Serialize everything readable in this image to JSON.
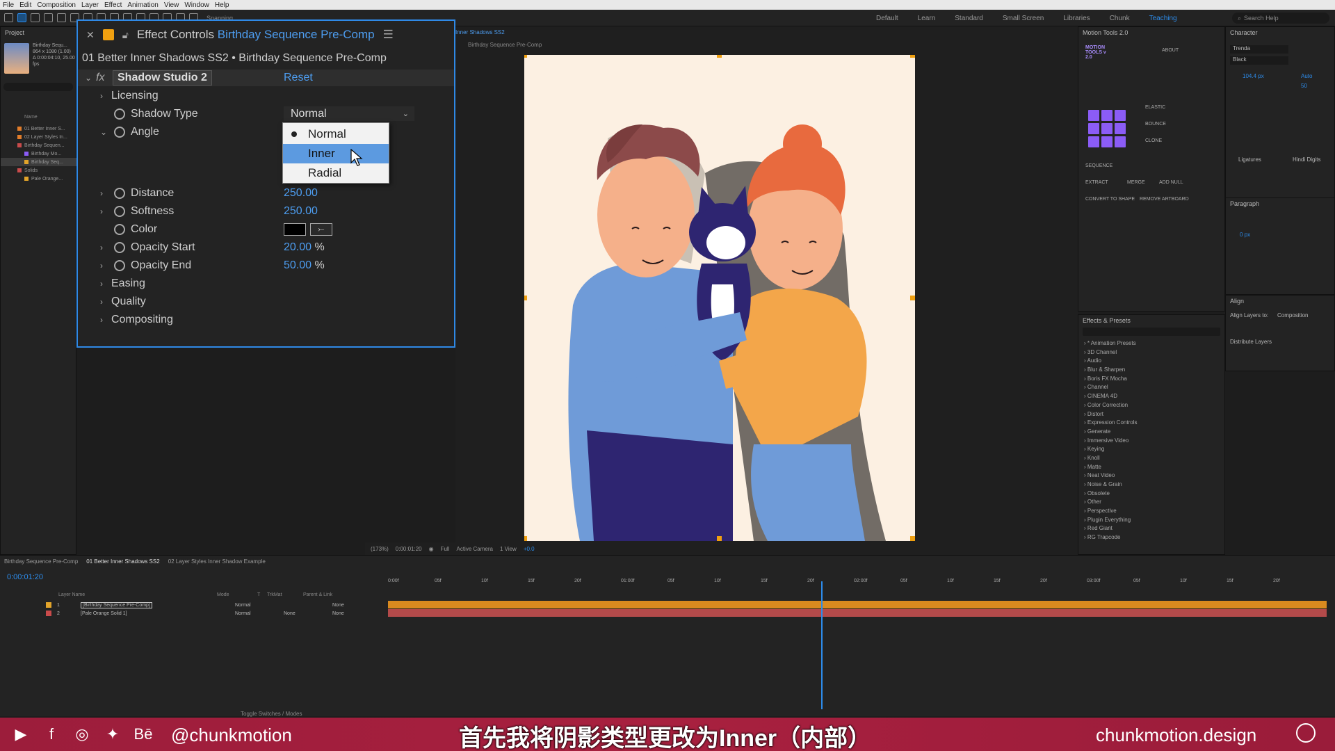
{
  "menu": [
    "File",
    "Edit",
    "Composition",
    "Layer",
    "Effect",
    "Animation",
    "View",
    "Window",
    "Help"
  ],
  "toolbar": {
    "snapping_label": "Snapping"
  },
  "workspaces": [
    "Default",
    "Learn",
    "Standard",
    "Small Screen",
    "Libraries",
    "Chunk",
    "Teaching"
  ],
  "active_workspace": "Teaching",
  "search_help": "Search Help",
  "project": {
    "tab": "Project",
    "item_name": "Birthday Sequ...",
    "item_info1": "864 x 1080 (1.00)",
    "item_info2": "Δ 0:00:04:10, 25.00 fps",
    "column": "Name",
    "rows": [
      "01 Better Inner S...",
      "02 Layer Styles In...",
      "Birthday Sequen...",
      "Birthday Mo...",
      "Birthday Seq...",
      "Solids",
      "Pale Orange..."
    ]
  },
  "effect_controls": {
    "title_prefix": "Effect Controls",
    "title_comp": "Birthday Sequence Pre-Comp",
    "subtitle": "01 Better Inner Shadows SS2 • Birthday Sequence Pre-Comp",
    "fx_label": "fx",
    "effect_name": "Shadow Studio 2",
    "reset": "Reset",
    "licensing": "Licensing",
    "shadow_type_label": "Shadow Type",
    "shadow_type_value": "Normal",
    "angle_label": "Angle",
    "distance_label": "Distance",
    "distance_value": "250.00",
    "softness_label": "Softness",
    "softness_value": "250.00",
    "color_label": "Color",
    "color_value": "#000000",
    "opacity_start_label": "Opacity Start",
    "opacity_start_value": "20.00",
    "opacity_end_label": "Opacity End",
    "opacity_end_value": "50.00",
    "percent": "%",
    "easing": "Easing",
    "quality": "Quality",
    "compositing": "Compositing"
  },
  "dropdown": {
    "options": [
      "Normal",
      "Inner",
      "Radial"
    ],
    "checked": "Normal",
    "highlighted": "Inner"
  },
  "composition": {
    "tab": "Inner Shadows SS2",
    "breadcrumb": "Birthday Sequence Pre-Comp",
    "zoom": "(173%)",
    "timecode": "0:00:01:20",
    "resolution": "Full",
    "camera": "Active Camera",
    "view": "1 View",
    "exposure": "+0.0"
  },
  "motion_tools": {
    "tab": "Motion Tools 2.0",
    "logo": "MOTION TOOLS v 2.0",
    "about": "ABOUT",
    "elastic": "ELASTIC",
    "bounce": "BOUNCE",
    "clone": "CLONE",
    "sequence": "SEQUENCE",
    "extract": "EXTRACT",
    "merge": "MERGE",
    "add_null": "ADD NULL",
    "convert": "CONVERT TO SHAPE",
    "remove_artboard": "REMOVE ARTBOARD"
  },
  "character": {
    "tab": "Character",
    "font": "Trenda",
    "style": "Black",
    "size": "104.4 px",
    "leading": "Auto",
    "tracking": "50",
    "ligatures": "Ligatures",
    "hindi": "Hindi Digits"
  },
  "paragraph": {
    "tab": "Paragraph",
    "px": "0 px"
  },
  "align": {
    "tab": "Align",
    "align_to_label": "Align Layers to:",
    "align_to": "Composition",
    "distribute": "Distribute Layers"
  },
  "effects_presets": {
    "tab": "Effects & Presets",
    "items": [
      "* Animation Presets",
      "3D Channel",
      "Audio",
      "Blur & Sharpen",
      "Boris FX Mocha",
      "Channel",
      "CINEMA 4D",
      "Color Correction",
      "Distort",
      "Expression Controls",
      "Generate",
      "Immersive Video",
      "Keying",
      "Knoll",
      "Matte",
      "Neat Video",
      "Noise & Grain",
      "Obsolete",
      "Other",
      "Perspective",
      "Plugin Everything",
      "Red Giant",
      "RG Trapcode"
    ]
  },
  "timeline": {
    "tabs": [
      "Birthday Sequence Pre-Comp",
      "01 Better Inner Shadows SS2",
      "02 Layer Styles Inner Shadow Example"
    ],
    "timecode": "0:00:01:20",
    "col_layer": "Layer Name",
    "col_mode": "Mode",
    "col_t": "T",
    "col_trkmat": "TrkMat",
    "col_parent": "Parent & Link",
    "layers": [
      {
        "num": "1",
        "name": "[Birthday Sequence Pre-Comp]",
        "mode": "Normal",
        "trkmat": "",
        "parent": "None"
      },
      {
        "num": "2",
        "name": "[Pale Orange Solid 1]",
        "mode": "Normal",
        "trkmat": "None",
        "parent": "None"
      }
    ],
    "ruler": [
      "0:00f",
      "05f",
      "10f",
      "15f",
      "20f",
      "01:00f",
      "05f",
      "10f",
      "15f",
      "20f",
      "02:00f",
      "05f",
      "10f",
      "15f",
      "20f",
      "03:00f",
      "05f",
      "10f",
      "15f",
      "20f"
    ],
    "toggle": "Toggle Switches / Modes"
  },
  "banner": {
    "handle": "@chunkmotion",
    "subtitle": "首先我将阴影类型更改为Inner（内部）",
    "site": "chunkmotion.design",
    "icons": [
      "youtube-icon",
      "facebook-icon",
      "instagram-icon",
      "twitter-icon",
      "behance-icon"
    ]
  },
  "colors": {
    "accent_blue": "#2d8ceb",
    "value_blue": "#4d9df0",
    "label_orange": "#f0a010",
    "banner_red": "#a8203f",
    "highlight": "#5c9ae0"
  }
}
